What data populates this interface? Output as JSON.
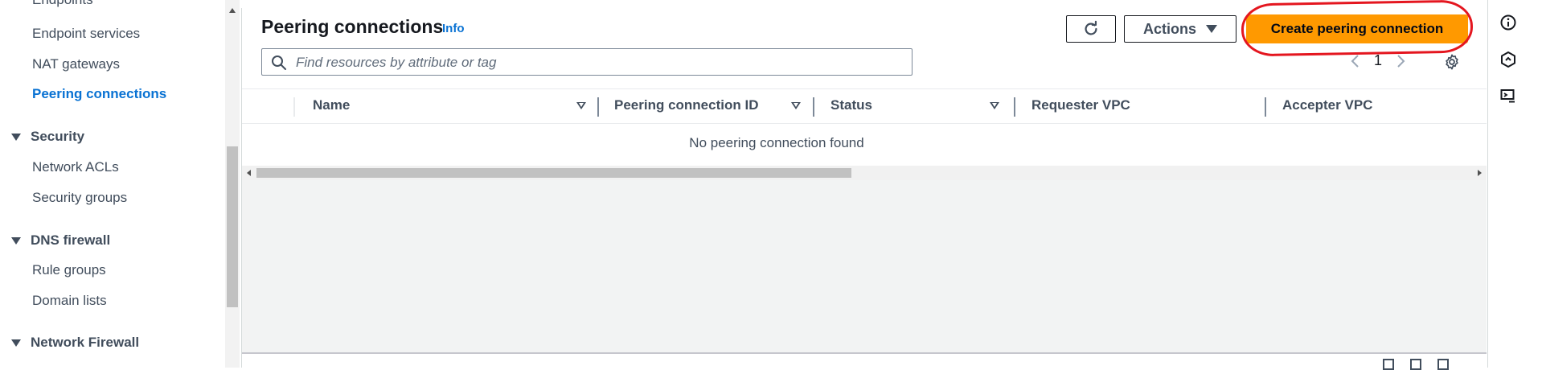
{
  "sidebar": {
    "items": [
      {
        "label": "Endpoints",
        "active": false
      },
      {
        "label": "Endpoint services",
        "active": false
      },
      {
        "label": "NAT gateways",
        "active": false
      },
      {
        "label": "Peering connections",
        "active": true
      }
    ],
    "sections": [
      {
        "title": "Security",
        "items": [
          "Network ACLs",
          "Security groups"
        ]
      },
      {
        "title": "DNS firewall",
        "items": [
          "Rule groups",
          "Domain lists"
        ]
      },
      {
        "title": "Network Firewall",
        "items": []
      }
    ]
  },
  "main": {
    "title": "Peering connections",
    "info_label": "Info",
    "actions_label": "Actions",
    "create_label": "Create peering connection",
    "search": {
      "placeholder": "Find resources by attribute or tag",
      "value": ""
    },
    "pagination": {
      "current_page": "1"
    },
    "table": {
      "columns": [
        "Name",
        "Peering connection ID",
        "Status",
        "Requester VPC",
        "Accepter VPC"
      ],
      "empty_message": "No peering connection found"
    }
  },
  "icons": {
    "refresh": "refresh-icon",
    "search": "search-icon",
    "settings": "gear-icon",
    "info": "info-icon",
    "notifications": "hexagon-icon",
    "feedback": "screen-feedback-icon"
  },
  "colors": {
    "primary_button": "#ff9900",
    "link": "#0972d3",
    "annotation": "#e4161f"
  }
}
